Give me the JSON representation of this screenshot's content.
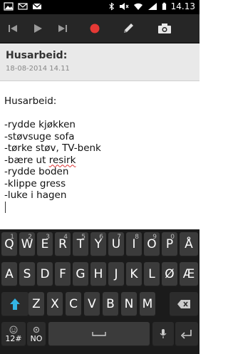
{
  "status_bar": {
    "time": "14.13",
    "left_icons": [
      "picture-icon",
      "mail-icon",
      "gmail-icon"
    ],
    "right_icons": [
      "bluetooth-icon",
      "mute-icon",
      "wifi-icon",
      "signal-icon",
      "battery-icon"
    ]
  },
  "toolbar": {
    "buttons": [
      "skip-back-icon",
      "play-icon",
      "skip-forward-icon",
      "record-icon",
      "pen-icon",
      "camera-icon"
    ]
  },
  "note": {
    "title": "Husarbeid:",
    "date": "18-08-2014 14.11",
    "lines": [
      "Husarbeid:",
      "",
      "-rydde kjøkken",
      "-støvsuge sofa",
      "-tørke støv, TV-benk",
      "-bære ut ",
      "-rydde boden",
      "-klippe gress",
      "-luke i hagen"
    ],
    "misspelled_prefix": "-bære ut ",
    "misspelled_word": "resirk"
  },
  "keyboard": {
    "row1": [
      "Q",
      "W",
      "E",
      "R",
      "T",
      "Y",
      "U",
      "I",
      "O",
      "P",
      "Å"
    ],
    "row1_secondary": [
      "1",
      "2",
      "3",
      "4",
      "5",
      "6",
      "7",
      "8",
      "9",
      "0",
      ""
    ],
    "row2": [
      "A",
      "S",
      "D",
      "F",
      "G",
      "H",
      "J",
      "K",
      "L",
      "Ø",
      "Æ"
    ],
    "row3": [
      "Z",
      "X",
      "C",
      "V",
      "B",
      "N",
      "M"
    ],
    "row4": [
      "12#",
      "NO"
    ],
    "colors": {
      "background": "#1b1b1b",
      "key": "#3b3b3b",
      "shift_accent": "#33b5e5"
    }
  }
}
